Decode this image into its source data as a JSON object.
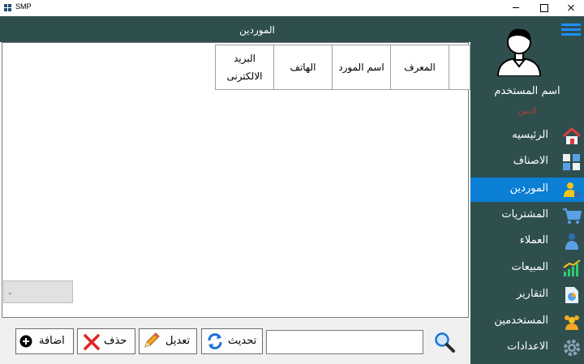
{
  "window": {
    "title": "SMP"
  },
  "header": {
    "title": "الموردين"
  },
  "user": {
    "name": "اسم المستخدم",
    "role": "ادمن"
  },
  "nav": {
    "items": [
      {
        "label": "الرئيسيه",
        "icon": "home-icon",
        "active": false
      },
      {
        "label": "الاصناف",
        "icon": "categories-icon",
        "active": false
      },
      {
        "label": "الموردين",
        "icon": "suppliers-icon",
        "active": true
      },
      {
        "label": "المشتريات",
        "icon": "cart-icon",
        "active": false
      },
      {
        "label": "العملاء",
        "icon": "customers-icon",
        "active": false
      },
      {
        "label": "المبيعات",
        "icon": "sales-chart-icon",
        "active": false
      },
      {
        "label": "التقارير",
        "icon": "report-icon",
        "active": false
      },
      {
        "label": "المستخدمين",
        "icon": "users-icon",
        "active": false
      },
      {
        "label": "الاعدادات",
        "icon": "gear-icon",
        "active": false
      }
    ]
  },
  "grid": {
    "columns": [
      "البريد الالكترنى",
      "الهاتف",
      "اسم المورد",
      "المعرف"
    ]
  },
  "combo": {
    "value": ""
  },
  "toolbar": {
    "add_label": "اضافة",
    "delete_label": "حذف",
    "edit_label": "تعديل",
    "refresh_label": "تحديث"
  },
  "search": {
    "value": "",
    "placeholder": ""
  },
  "colors": {
    "sidebar": "#2f4f4f",
    "active_item": "#0a7fd4",
    "role_text": "#c0392b",
    "accent": "#1e90ff"
  }
}
